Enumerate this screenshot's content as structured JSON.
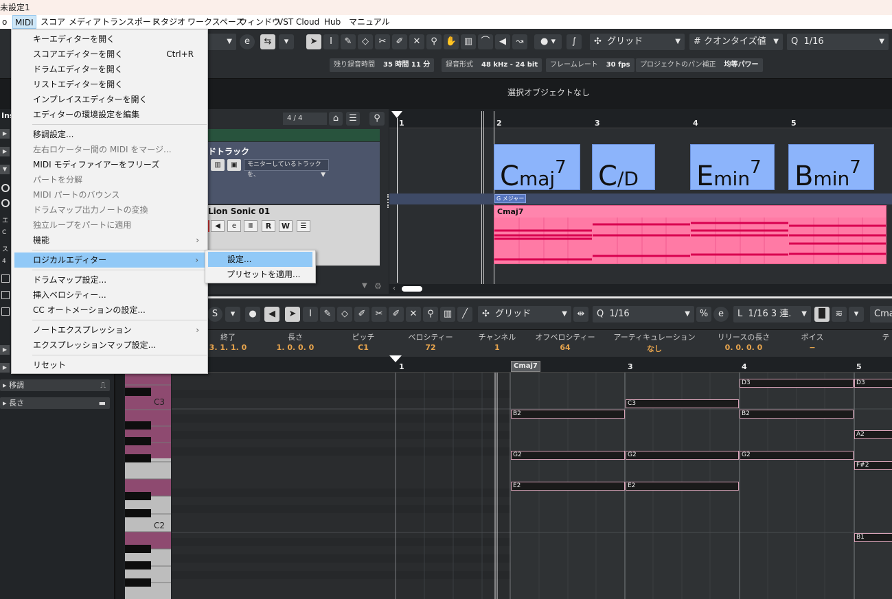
{
  "window_title": "未設定1",
  "menubar": {
    "items": [
      "o",
      "MIDI",
      "スコア",
      "メディア",
      "トランスポート",
      "スタジオ",
      "ワークスペース",
      "ウィンドウ",
      "VST Cloud",
      "Hub",
      "マニュアル"
    ]
  },
  "toolbar": {
    "grid_label": "グリッド",
    "quantize_type": "クオンタイズ値",
    "quantize_value": "1/16",
    "q_symbol": "Q"
  },
  "status": {
    "rec_time_label": "残り録音時間",
    "rec_time_value": "35 時間 11 分",
    "rec_format_label": "録音形式",
    "rec_format_value": "48 kHz - 24 bit",
    "frame_rate_label": "フレームレート",
    "frame_rate_value": "30 fps",
    "pan_label": "プロジェクトのパン補正",
    "pan_value": "均等パワー"
  },
  "info_line": "選択オブジェクトなし",
  "project": {
    "time_sig": "4 / 4",
    "ruler": [
      "1",
      "2",
      "3",
      "4",
      "5"
    ],
    "chord_track_name": "ドトラック",
    "monitor_dropdown": "モニターしているトラックを、",
    "instrument_track_name": "Lion Sonic 01",
    "track_buttons": [
      "R",
      "W"
    ],
    "scale_label": "G メジャー",
    "part_label": "Cmaj7",
    "chords": [
      {
        "root": "C",
        "quality": "maj",
        "ext": "7"
      },
      {
        "root": "C",
        "quality": "/D",
        "ext": ""
      },
      {
        "root": "E",
        "quality": "min",
        "ext": "7"
      },
      {
        "root": "B",
        "quality": "min",
        "ext": "7"
      }
    ]
  },
  "left_panel": {
    "ins": "Ins",
    "letters": [
      "エ",
      "C",
      "ス",
      "4"
    ],
    "transpose": "移調",
    "length": "長さ"
  },
  "midi_menu": {
    "items": [
      {
        "label": "キーエディターを開く"
      },
      {
        "label": "スコアエディターを開く",
        "shortcut": "Ctrl+R"
      },
      {
        "label": "ドラムエディターを開く"
      },
      {
        "label": "リストエディターを開く"
      },
      {
        "label": "インプレイスエディターを開く"
      },
      {
        "label": "エディターの環境設定を編集"
      },
      {
        "label": "移調設定..."
      },
      {
        "label": "左右ロケーター間の MIDI をマージ...",
        "disabled": true
      },
      {
        "label": "MIDI モディファイアーをフリーズ"
      },
      {
        "label": "パートを分解",
        "disabled": true
      },
      {
        "label": "MIDI パートのバウンス",
        "disabled": true
      },
      {
        "label": "ドラムマップ出力ノートの変換",
        "disabled": true
      },
      {
        "label": "独立ループをパートに適用",
        "disabled": true
      },
      {
        "label": "機能",
        "submenu": true
      },
      {
        "label": "ロジカルエディター",
        "submenu": true
      },
      {
        "label": "ドラムマップ設定..."
      },
      {
        "label": "挿入ベロシティー..."
      },
      {
        "label": "CC オートメーションの設定..."
      },
      {
        "label": "ノートエクスプレッション",
        "submenu": true
      },
      {
        "label": "エクスプレッションマップ設定..."
      },
      {
        "label": "リセット"
      }
    ],
    "submenu_arrow": "›"
  },
  "logical_submenu": {
    "items": [
      "設定...",
      "プリセットを適用..."
    ]
  },
  "key_editor": {
    "grid_label": "グリッド",
    "quantize": "1/16",
    "length_q": "1/16 3 連.",
    "chord_field": "Cma",
    "info_headers": [
      "終了",
      "長さ",
      "ピッチ",
      "ベロシティー",
      "チャンネル",
      "オフベロシティー",
      "アーティキュレーション",
      "リリースの長さ",
      "ボイス",
      "テ"
    ],
    "info_values": [
      "3. 1. 1.   0",
      "1. 0. 0.   0",
      "C1",
      "72",
      "1",
      "64",
      "なし",
      "0. 0. 0.   0",
      "−",
      ""
    ],
    "ruler": [
      "1",
      "3",
      "4",
      "5"
    ],
    "part_label": "Cmaj7",
    "key_labels": [
      "C3",
      "C2"
    ],
    "notes": [
      {
        "pitch": "D3",
        "start": 4,
        "end": 5
      },
      {
        "pitch": "D3",
        "start": 5,
        "end": 5.35
      },
      {
        "pitch": "C3",
        "start": 3,
        "end": 4
      },
      {
        "pitch": "B2",
        "start": 2,
        "end": 3
      },
      {
        "pitch": "B2",
        "start": 4,
        "end": 5
      },
      {
        "pitch": "A2",
        "start": 5,
        "end": 5.35
      },
      {
        "pitch": "G2",
        "start": 2,
        "end": 3
      },
      {
        "pitch": "G2",
        "start": 3,
        "end": 4
      },
      {
        "pitch": "G2",
        "start": 4,
        "end": 5
      },
      {
        "pitch": "F#2",
        "start": 5,
        "end": 5.35
      },
      {
        "pitch": "E2",
        "start": 2,
        "end": 3
      },
      {
        "pitch": "E2",
        "start": 3,
        "end": 4
      },
      {
        "pitch": "B1",
        "start": 5,
        "end": 5.35
      }
    ]
  }
}
